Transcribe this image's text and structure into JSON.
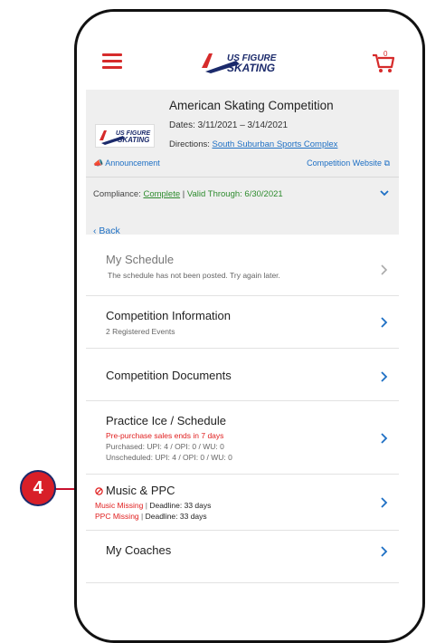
{
  "header": {
    "logo_text_line1": "US FIGURE",
    "logo_text_line2": "SKATING",
    "cart_count": "0"
  },
  "competition": {
    "name": "American Skating Competition",
    "dates": "Dates: 3/11/2021 – 3/14/2021",
    "directions_label": "Directions:",
    "directions_link": "South Suburban Sports Complex",
    "announcement": "Announcement",
    "website": "Competition Website",
    "compliance_label": "Compliance:",
    "compliance_status": "Complete",
    "valid_through": "Valid Through: 6/30/2021"
  },
  "nav": {
    "back_label": "Back"
  },
  "rows": {
    "my_schedule": {
      "title": "My Schedule",
      "sub": "The schedule has not been posted. Try again later."
    },
    "competition_information": {
      "title": "Competition Information",
      "sub": "2 Registered Events"
    },
    "competition_documents": {
      "title": "Competition Documents"
    },
    "practice_ice": {
      "title": "Practice Ice / Schedule",
      "alert": "Pre-purchase sales ends in 7 days",
      "purchased": "Purchased: UPI: 4 / OPI: 0 / WU: 0",
      "unscheduled": "Unscheduled: UPI: 4 / OPI: 0 / WU: 0"
    },
    "music_ppc": {
      "title": "Music & PPC",
      "music_status": "Music Missing",
      "music_deadline": "Deadline: 33 days",
      "ppc_status": "PPC Missing",
      "ppc_deadline": "Deadline: 33 days"
    },
    "my_coaches": {
      "title": "My Coaches"
    }
  },
  "callout": {
    "number": "4"
  },
  "colors": {
    "accent_red": "#d62b2b",
    "link_blue": "#1d6fc4",
    "brand_navy": "#1b2a6b",
    "ok_green": "#2e8b2e"
  }
}
